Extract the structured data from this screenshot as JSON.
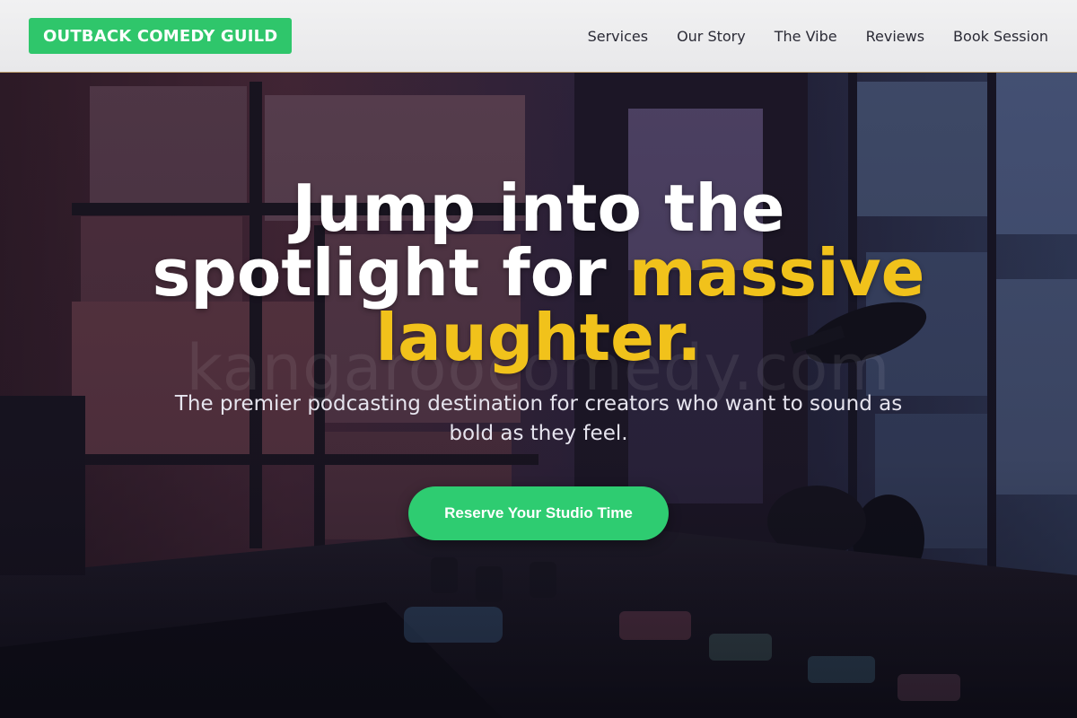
{
  "brand": {
    "name": "OUTBACK COMEDY GUILD"
  },
  "nav": {
    "links": [
      "Services",
      "Our Story",
      "The Vibe",
      "Reviews",
      "Book Session"
    ]
  },
  "hero": {
    "headline_part1": "Jump into the spotlight for ",
    "headline_accent": "massive laughter.",
    "subtitle": "The premier podcasting destination for creators who want to sound as bold as they feel.",
    "cta_label": "Reserve Your Studio Time",
    "watermark": "kangaroocomedy.com"
  },
  "colors": {
    "brand_green": "#2fc66b",
    "cta_green": "#2ecc71",
    "accent_yellow": "#f1c21b",
    "nav_text": "#2a2a35"
  }
}
